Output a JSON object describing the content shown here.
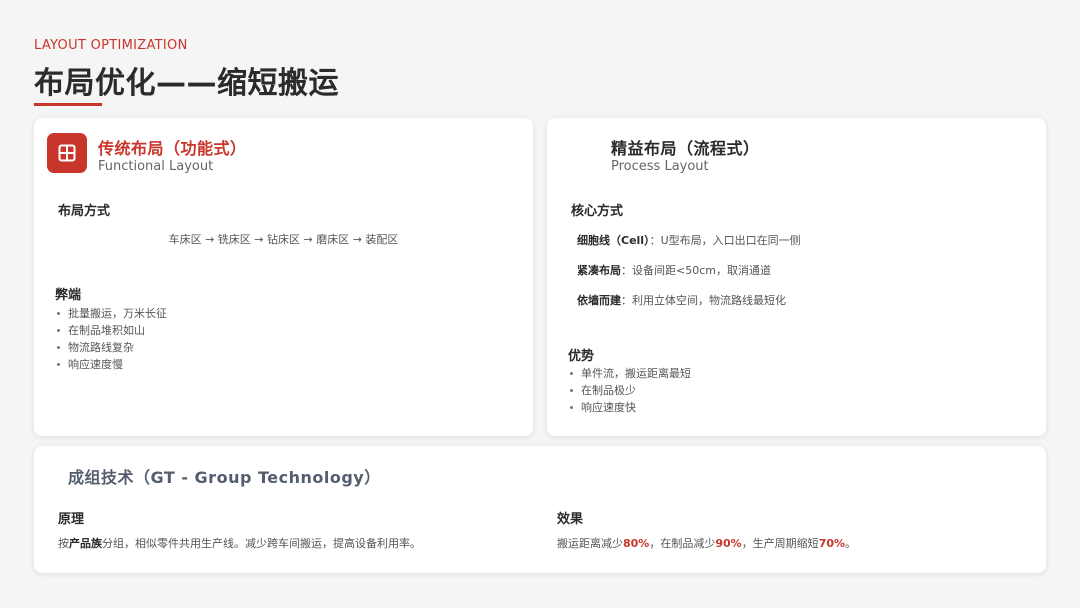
{
  "header": {
    "eyebrow": "LAYOUT OPTIMIZATION",
    "title": "布局优化——缩短搬运",
    "accent_color": "#c8362b"
  },
  "traditional": {
    "icon": "grid-icon",
    "title": "传统布局（功能式）",
    "subtitle": "Functional Layout",
    "method_heading": "布局方式",
    "flow": "车床区 → 铣床区 → 钻床区 → 磨床区 → 装配区",
    "cons_heading": "弊端",
    "cons": [
      "批量搬运，万米长征",
      "在制品堆积如山",
      "物流路线复杂",
      "响应速度慢"
    ]
  },
  "lean": {
    "title": "精益布局（流程式）",
    "subtitle": "Process Layout",
    "core_heading": "核心方式",
    "core_items": [
      {
        "term": "细胞线（Cell）",
        "sep": "：",
        "desc": "U型布局，入口出口在同一侧"
      },
      {
        "term": "紧凑布局",
        "sep": "：",
        "desc": "设备间距<50cm，取消通道"
      },
      {
        "term": "依墙而建",
        "sep": "：",
        "desc": "利用立体空间，物流路线最短化"
      }
    ],
    "pros_heading": "优势",
    "pros": [
      "单件流，搬运距离最短",
      "在制品极少",
      "响应速度快"
    ]
  },
  "gt": {
    "title": "成组技术（GT - Group Technology）",
    "principle_heading": "原理",
    "principle_pre": "按",
    "principle_bold": "产品族",
    "principle_post": "分组，相似零件共用生产线。减少跨车间搬运，提高设备利用率。",
    "effect_heading": "效果",
    "effect_parts": [
      "搬运距离减少",
      "80%",
      "，在制品减少",
      "90%",
      "，生产周期缩短",
      "70%",
      "。"
    ]
  }
}
